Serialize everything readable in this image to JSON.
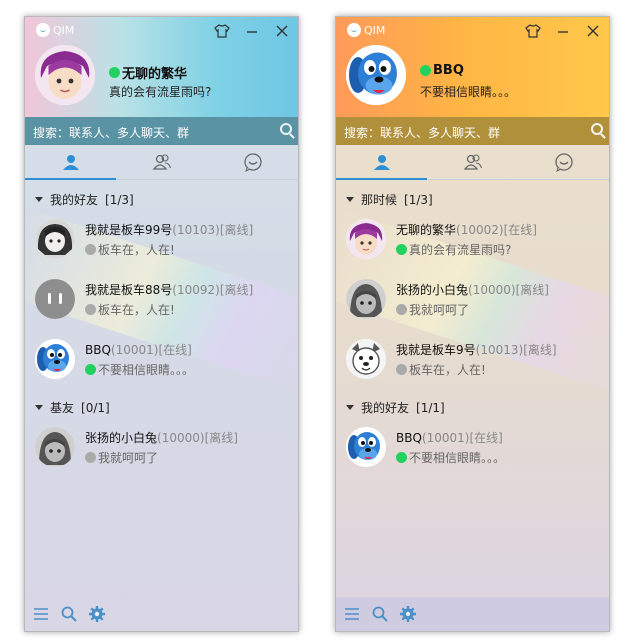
{
  "windows": [
    {
      "app_logo": "QIM",
      "profile": {
        "name": "无聊的繁华",
        "status": "online",
        "signature": "真的会有流星雨吗?",
        "avatar": "purple-hair-girl-avatar"
      },
      "search_placeholder": "搜索：联系人、多人聊天、群",
      "active_tab": "contacts",
      "groups": [
        {
          "title": "我的好友",
          "count": "[1/3]",
          "friends": [
            {
              "name": "我就是板车99号",
              "id": "(10103)",
              "status": "[离线]",
              "online": false,
              "signature": "板车在，人在!",
              "avatar": "dark-hair-girl-avatar"
            },
            {
              "name": "我就是板车88号",
              "id": "(10092)",
              "status": "[离线]",
              "online": false,
              "signature": "板车在，人在!",
              "avatar": "gray-default-avatar"
            },
            {
              "name": "BBQ",
              "id": "(10001)",
              "status": "[在线]",
              "online": true,
              "signature": "不要相信眼睛。。。",
              "avatar": "blue-dog-avatar"
            }
          ]
        },
        {
          "title": "基友",
          "count": "[0/1]",
          "friends": [
            {
              "name": "张扬的小白兔",
              "id": "(10000)",
              "status": "[离线]",
              "online": false,
              "signature": "我就呵呵了",
              "avatar": "hooded-character-avatar"
            }
          ]
        }
      ]
    },
    {
      "app_logo": "QIM",
      "profile": {
        "name": "BBQ",
        "status": "online",
        "signature": "不要相信眼睛。。。",
        "avatar": "blue-dog-avatar"
      },
      "search_placeholder": "搜索：联系人、多人聊天、群",
      "active_tab": "contacts",
      "groups": [
        {
          "title": "那时候",
          "count": "[1/3]",
          "friends": [
            {
              "name": "无聊的繁华",
              "id": "(10002)",
              "status": "[在线]",
              "online": true,
              "signature": "真的会有流星雨吗?",
              "avatar": "purple-hair-girl-avatar"
            },
            {
              "name": "张扬的小白兔",
              "id": "(10000)",
              "status": "[离线]",
              "online": false,
              "signature": "我就呵呵了",
              "avatar": "hooded-character-avatar"
            },
            {
              "name": "我就是板车9号",
              "id": "(10013)",
              "status": "[离线]",
              "online": false,
              "signature": "板车在，人在!",
              "avatar": "white-cartoon-dog-avatar"
            }
          ]
        },
        {
          "title": "我的好友",
          "count": "[1/1]",
          "friends": [
            {
              "name": "BBQ",
              "id": "(10001)",
              "status": "[在线]",
              "online": true,
              "signature": "不要相信眼睛。。。",
              "avatar": "blue-dog-avatar"
            }
          ]
        }
      ]
    }
  ],
  "colors": {
    "online": "#23d160",
    "offline": "#aaaaaa",
    "tab_active": "#2f8fd6"
  }
}
